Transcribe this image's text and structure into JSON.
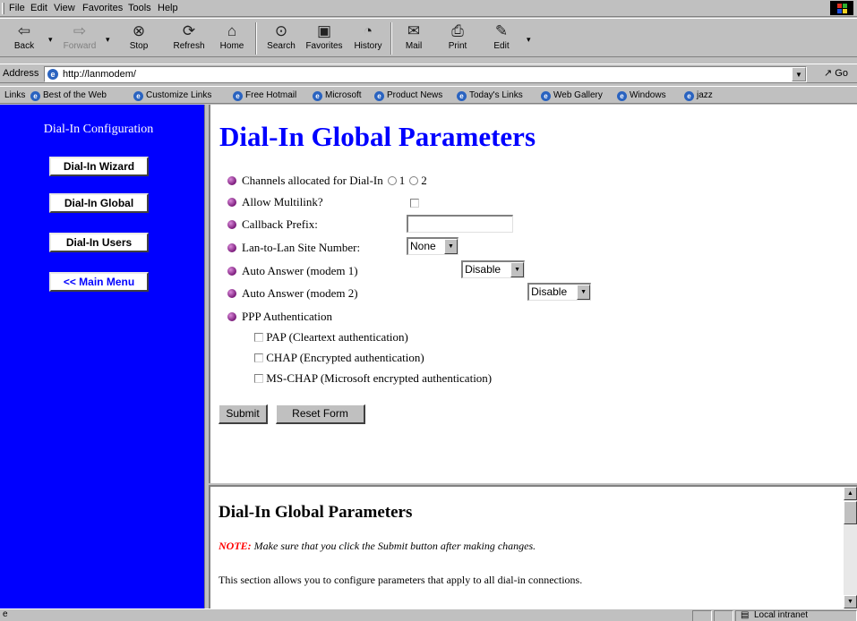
{
  "menu": [
    "File",
    "Edit",
    "View",
    "Favorites",
    "Tools",
    "Help"
  ],
  "toolbar": {
    "back": "Back",
    "forward": "Forward",
    "stop": "Stop",
    "refresh": "Refresh",
    "home": "Home",
    "search": "Search",
    "favorites": "Favorites",
    "history": "History",
    "mail": "Mail",
    "print": "Print",
    "edit": "Edit"
  },
  "address": {
    "label": "Address",
    "url": "http://lanmodem/",
    "go": "Go"
  },
  "links": {
    "label": "Links",
    "items": [
      "Best of the Web",
      "Customize Links",
      "Free Hotmail",
      "Microsoft",
      "Product News",
      "Today's Links",
      "Web Gallery",
      "Windows",
      "jazz"
    ]
  },
  "sidebar": {
    "title": "Dial-In Configuration",
    "buttons": [
      "Dial-In Wizard",
      "Dial-In Global",
      "Dial-In Users",
      "<< Main Menu"
    ]
  },
  "main": {
    "title": "Dial-In Global Parameters",
    "channels_label": "Channels allocated for Dial-In",
    "channel_options": [
      "1",
      "2"
    ],
    "multilink_label": "Allow Multilink?",
    "callback_label": "Callback Prefix:",
    "callback_value": "",
    "site_label": "Lan-to-Lan Site Number:",
    "site_value": "None",
    "auto1_label": "Auto Answer (modem 1)",
    "auto1_value": "Disable",
    "auto2_label": "Auto Answer (modem 2)",
    "auto2_value": "Disable",
    "ppp_label": "PPP Authentication",
    "ppp_options": [
      "PAP (Cleartext authentication)",
      "CHAP (Encrypted authentication)",
      "MS-CHAP (Microsoft encrypted authentication)"
    ],
    "submit": "Submit",
    "reset": "Reset Form"
  },
  "help": {
    "title": "Dial-In Global Parameters",
    "note_label": "NOTE:",
    "note_text": " Make sure that you click the Submit button after making changes.",
    "text": "This section allows you to configure parameters that apply to all dial-in connections."
  },
  "status": {
    "zone": "Local intranet"
  },
  "colors": {
    "sidebar_bg": "#0000ff",
    "title": "#0000ff",
    "note": "#ff0000",
    "chrome": "#c0c0c0"
  }
}
